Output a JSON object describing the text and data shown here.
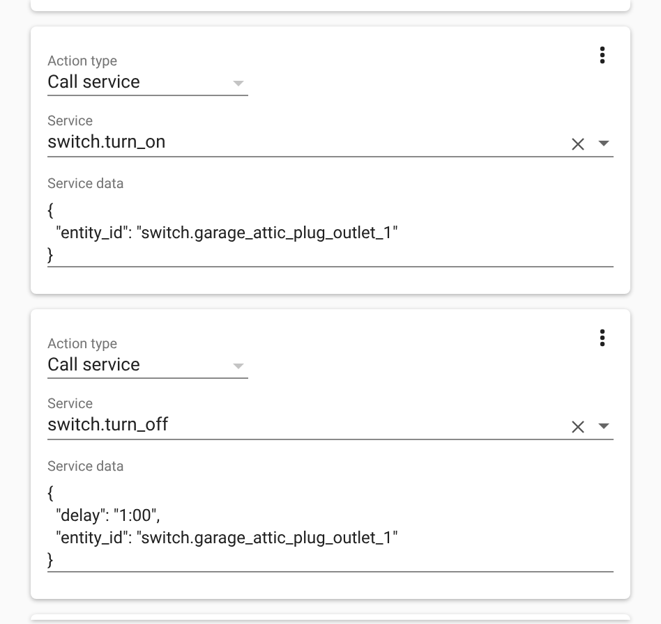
{
  "actions": [
    {
      "action_type": {
        "label": "Action type",
        "value": "Call service"
      },
      "service": {
        "label": "Service",
        "value": "switch.turn_on"
      },
      "service_data": {
        "label": "Service data",
        "value": "{\n  \"entity_id\": \"switch.garage_attic_plug_outlet_1\"\n}"
      }
    },
    {
      "action_type": {
        "label": "Action type",
        "value": "Call service"
      },
      "service": {
        "label": "Service",
        "value": "switch.turn_off"
      },
      "service_data": {
        "label": "Service data",
        "value": "{\n  \"delay\": \"1:00\",\n  \"entity_id\": \"switch.garage_attic_plug_outlet_1\"\n}"
      }
    }
  ]
}
